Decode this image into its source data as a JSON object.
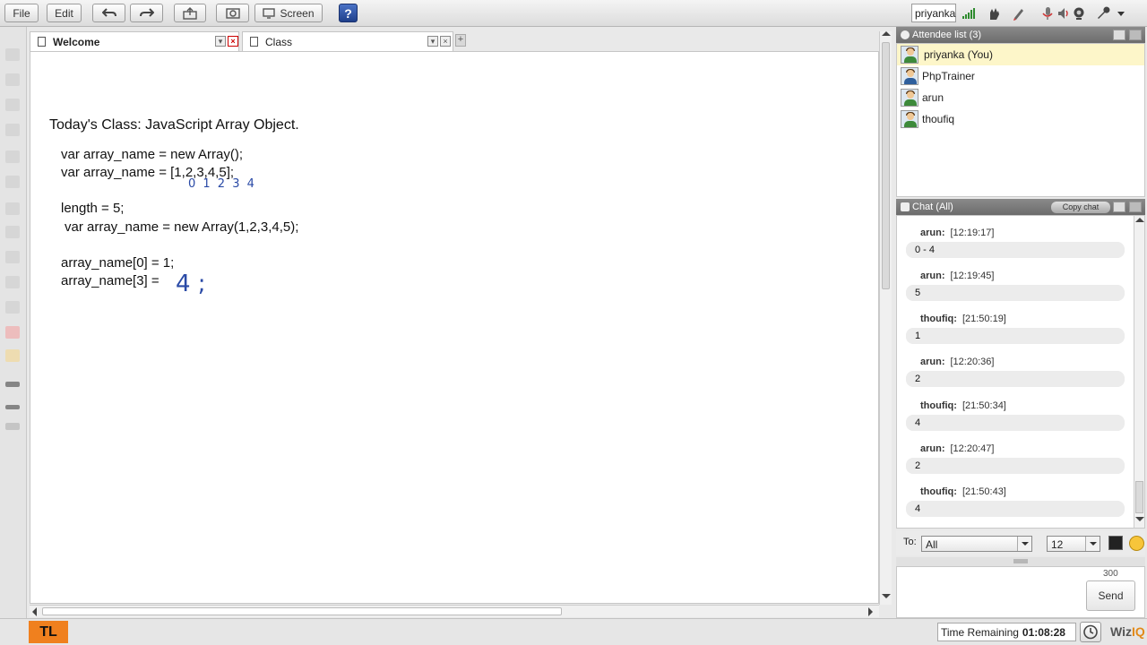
{
  "toolbar": {
    "file": "File",
    "edit": "Edit",
    "screen": "Screen",
    "help": "?",
    "username": "priyanka"
  },
  "tabs": [
    {
      "label": "Welcome"
    },
    {
      "label": "Class"
    }
  ],
  "board": {
    "title": "Today's Class: JavaScript Array Object.",
    "lines": [
      "var array_name = new Array();",
      "var array_name = [1,2,3,4,5];",
      "length = 5;",
      "var array_name = new Array(1,2,3,4,5);",
      "array_name[0] = 1;",
      "array_name[3] ="
    ],
    "handwriting": {
      "indices": "0 1 2 3 4",
      "answer": "4 ;"
    }
  },
  "attendees": {
    "header": "Attendee list (3)",
    "list": [
      {
        "name": "priyanka (You)",
        "shirt": "#3d8a3a"
      },
      {
        "name": "PhpTrainer",
        "shirt": "#2f5f9c"
      },
      {
        "name": "arun",
        "shirt": "#3d8a3a"
      },
      {
        "name": "thoufiq",
        "shirt": "#3d8a3a"
      }
    ]
  },
  "chat": {
    "header": "Chat (All)",
    "copy_label": "Copy chat",
    "messages": [
      {
        "from": "arun:",
        "time": "[12:19:17]",
        "text": "0 - 4"
      },
      {
        "from": "arun:",
        "time": "[12:19:45]",
        "text": "5"
      },
      {
        "from": "thoufiq:",
        "time": "[21:50:19]",
        "text": "1"
      },
      {
        "from": "arun:",
        "time": "[12:20:36]",
        "text": "2"
      },
      {
        "from": "thoufiq:",
        "time": "[21:50:34]",
        "text": "4"
      },
      {
        "from": "arun:",
        "time": "[12:20:47]",
        "text": "2"
      },
      {
        "from": "thoufiq:",
        "time": "[21:50:43]",
        "text": "4"
      }
    ],
    "to_label": "To:",
    "to_value": "All",
    "font_size": "12",
    "char_count": "300",
    "send_label": "Send"
  },
  "footer": {
    "logo": "TL",
    "time_label": "Time Remaining",
    "time_value": "01:08:28",
    "brand": "Wiz",
    "brand_accent": "IQ"
  }
}
